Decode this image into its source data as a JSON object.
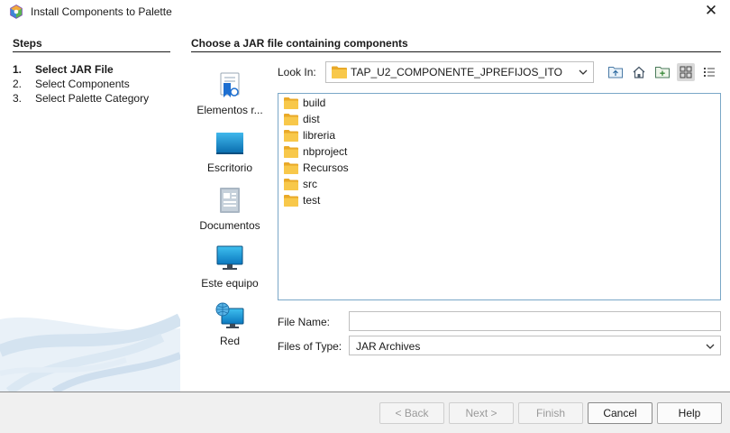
{
  "window": {
    "title": "Install Components to Palette",
    "close_glyph": "✕"
  },
  "steps": {
    "header": "Steps",
    "items": [
      {
        "num": "1.",
        "label": "Select JAR File",
        "active": true
      },
      {
        "num": "2.",
        "label": "Select Components",
        "active": false
      },
      {
        "num": "3.",
        "label": "Select Palette Category",
        "active": false
      }
    ]
  },
  "content": {
    "header": "Choose a JAR file containing components"
  },
  "places": [
    {
      "label": "Elementos r...",
      "icon": "recent-items-icon"
    },
    {
      "label": "Escritorio",
      "icon": "desktop-icon"
    },
    {
      "label": "Documentos",
      "icon": "documents-icon"
    },
    {
      "label": "Este equipo",
      "icon": "this-pc-icon"
    },
    {
      "label": "Red",
      "icon": "network-icon"
    }
  ],
  "look_in": {
    "label": "Look In:",
    "value": "TAP_U2_COMPONENTE_JPREFIJOS_ITO"
  },
  "toolbar": {
    "buttons": [
      "up-folder-icon",
      "home-icon",
      "new-folder-icon",
      "list-view-icon",
      "details-view-icon"
    ]
  },
  "files": [
    "build",
    "dist",
    "libreria",
    "nbproject",
    "Recursos",
    "src",
    "test"
  ],
  "file_name": {
    "label": "File Name:",
    "value": ""
  },
  "file_type": {
    "label": "Files of Type:",
    "value": "JAR Archives"
  },
  "buttons": {
    "back": "< Back",
    "next": "Next >",
    "finish": "Finish",
    "cancel": "Cancel",
    "help": "Help"
  },
  "colors": {
    "folder": "#f6c343",
    "accent_border": "#7aa7c7",
    "divider": "#1a1a1a"
  }
}
